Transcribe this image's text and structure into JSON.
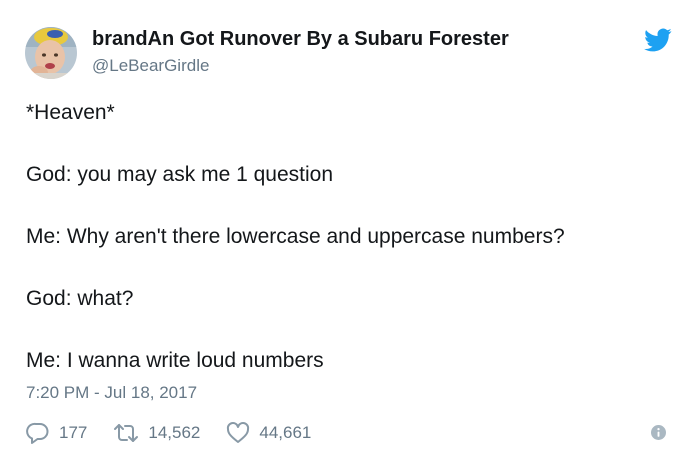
{
  "tweet": {
    "display_name": "brandAn Got Runover By a Subaru Forester",
    "handle": "@LeBearGirdle",
    "lines": [
      "*Heaven*",
      "God: you may ask me 1 question",
      "Me: Why aren't there lowercase and uppercase numbers?",
      "God: what?",
      "Me: I wanna write loud numbers"
    ],
    "timestamp": "7:20 PM - Jul 18, 2017",
    "stats": {
      "replies": "177",
      "retweets": "14,562",
      "likes": "44,661"
    }
  },
  "icons": {
    "brand": "twitter-bird-icon",
    "reply": "reply-bubble-icon",
    "retweet": "retweet-icon",
    "like": "heart-icon",
    "info": "info-icon"
  },
  "colors": {
    "brand_blue": "#1da1f2",
    "text": "#14171a",
    "secondary_text": "#657786",
    "icon_gray": "#8899a6"
  }
}
